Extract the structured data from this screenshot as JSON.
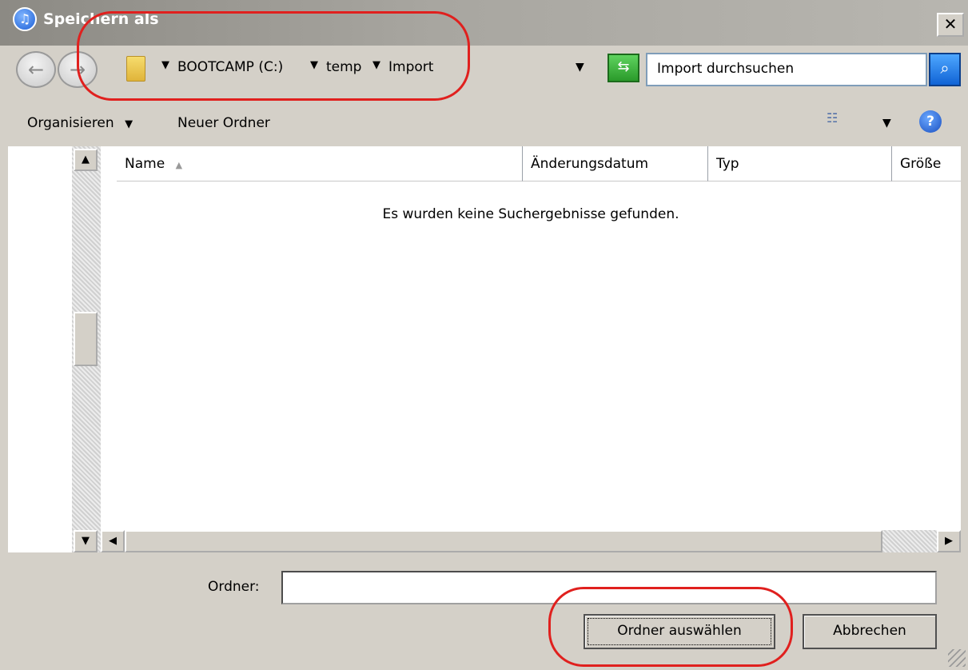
{
  "window": {
    "title": "Speichern als",
    "close_label": "✕"
  },
  "nav": {
    "breadcrumb": [
      "BOOTCAMP (C:)",
      "temp",
      "Import"
    ],
    "search_placeholder": "Import durchsuchen"
  },
  "toolbar": {
    "organize_label": "Organisieren",
    "new_folder_label": "Neuer Ordner"
  },
  "file_list": {
    "columns": [
      "Name",
      "Änderungsdatum",
      "Typ",
      "Größe"
    ],
    "empty_message": "Es wurden keine Suchergebnisse gefunden."
  },
  "bottom": {
    "folder_label": "Ordner:",
    "folder_value": "",
    "select_button": "Ordner auswählen",
    "cancel_button": "Abbrechen"
  },
  "colors": {
    "annotation": "#e0201e",
    "dialog_bg": "#d4d0c8"
  }
}
